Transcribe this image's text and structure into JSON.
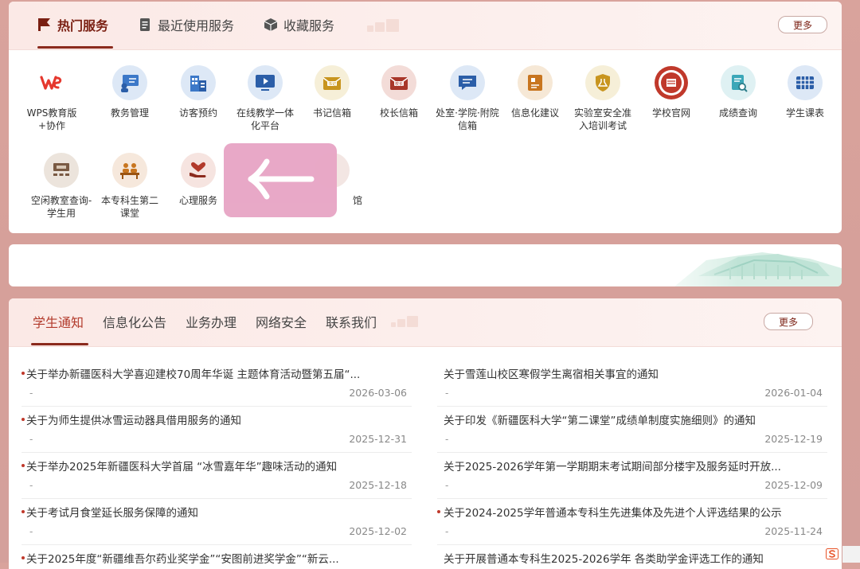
{
  "services": {
    "tabs": [
      {
        "label": "热门服务",
        "icon": "flag-icon",
        "active": true
      },
      {
        "label": "最近使用服务",
        "icon": "document-icon",
        "active": false
      },
      {
        "label": "收藏服务",
        "icon": "box-icon",
        "active": false
      }
    ],
    "more_label": "更多",
    "items": [
      {
        "label": "WPS教育版+协作",
        "icon": "wps-icon"
      },
      {
        "label": "教务管理",
        "icon": "teacher-board-icon"
      },
      {
        "label": "访客预约",
        "icon": "building-icon"
      },
      {
        "label": "在线教学一体化平台",
        "icon": "monitor-play-icon"
      },
      {
        "label": "书记信箱",
        "icon": "secretary-mailbox-icon",
        "badge": "书记"
      },
      {
        "label": "校长信箱",
        "icon": "president-mailbox-icon",
        "badge": "校长"
      },
      {
        "label": "处室·学院·附院信箱",
        "icon": "chat-message-icon"
      },
      {
        "label": "信息化建议",
        "icon": "suggestion-board-icon"
      },
      {
        "label": "实验室安全准入培训考试",
        "icon": "shield-flask-icon"
      },
      {
        "label": "学校官网",
        "icon": "university-seal-icon"
      },
      {
        "label": "成绩查询",
        "icon": "grade-document-icon"
      },
      {
        "label": "学生课表",
        "icon": "calendar-grid-icon"
      },
      {
        "label": "空闲教室查询-学生用",
        "icon": "classroom-icon"
      },
      {
        "label": "本专科生第二课堂",
        "icon": "students-desk-icon"
      },
      {
        "label": "心理服务",
        "icon": "heart-hand-icon"
      },
      {
        "label": "馆",
        "icon": "library-icon"
      }
    ],
    "overlay_icon": "arrow-left-icon"
  },
  "notices": {
    "tabs": [
      {
        "label": "学生通知",
        "active": true
      },
      {
        "label": "信息化公告",
        "active": false
      },
      {
        "label": "业务办理",
        "active": false
      },
      {
        "label": "网络安全",
        "active": false
      },
      {
        "label": "联系我们",
        "active": false
      }
    ],
    "more_label": "更多",
    "left": [
      {
        "title": "关于举办新疆医科大学喜迎建校70周年华诞 主题体育活动暨第五届“...",
        "date": "2026-03-06",
        "dash": "-",
        "dot": true
      },
      {
        "title": "关于为师生提供冰雪运动器具借用服务的通知",
        "date": "2025-12-31",
        "dash": "-",
        "dot": true
      },
      {
        "title": "关于举办2025年新疆医科大学首届 “冰雪嘉年华”趣味活动的通知",
        "date": "2025-12-18",
        "dash": "-",
        "dot": true
      },
      {
        "title": "关于考试月食堂延长服务保障的通知",
        "date": "2025-12-02",
        "dash": "-",
        "dot": true
      },
      {
        "title": "关于2025年度“新疆维吾尔药业奖学金”“安图前进奖学金”“新云...",
        "date": "",
        "dash": "",
        "dot": true
      }
    ],
    "right": [
      {
        "title": "关于雪莲山校区寒假学生离宿相关事宜的通知",
        "date": "2026-01-04",
        "dash": "-",
        "dot": false
      },
      {
        "title": "关于印发《新疆医科大学“第二课堂”成绩单制度实施细则》的通知",
        "date": "2025-12-19",
        "dash": "-",
        "dot": false
      },
      {
        "title": "关于2025-2026学年第一学期期末考试期间部分楼宇及服务延时开放...",
        "date": "2025-12-09",
        "dash": "-",
        "dot": false
      },
      {
        "title": "关于2024-2025学年普通本专科生先进集体及先进个人评选结果的公示",
        "date": "2025-11-24",
        "dash": "-",
        "dot": true
      },
      {
        "title": "关于开展普通本专科生2025-2026学年 各类助学金评选工作的通知",
        "date": "",
        "dash": "",
        "dot": false
      }
    ]
  },
  "colors": {
    "accent": "#8b2a1d",
    "active_notice": "#b23a2b",
    "background": "#d9a39c"
  }
}
